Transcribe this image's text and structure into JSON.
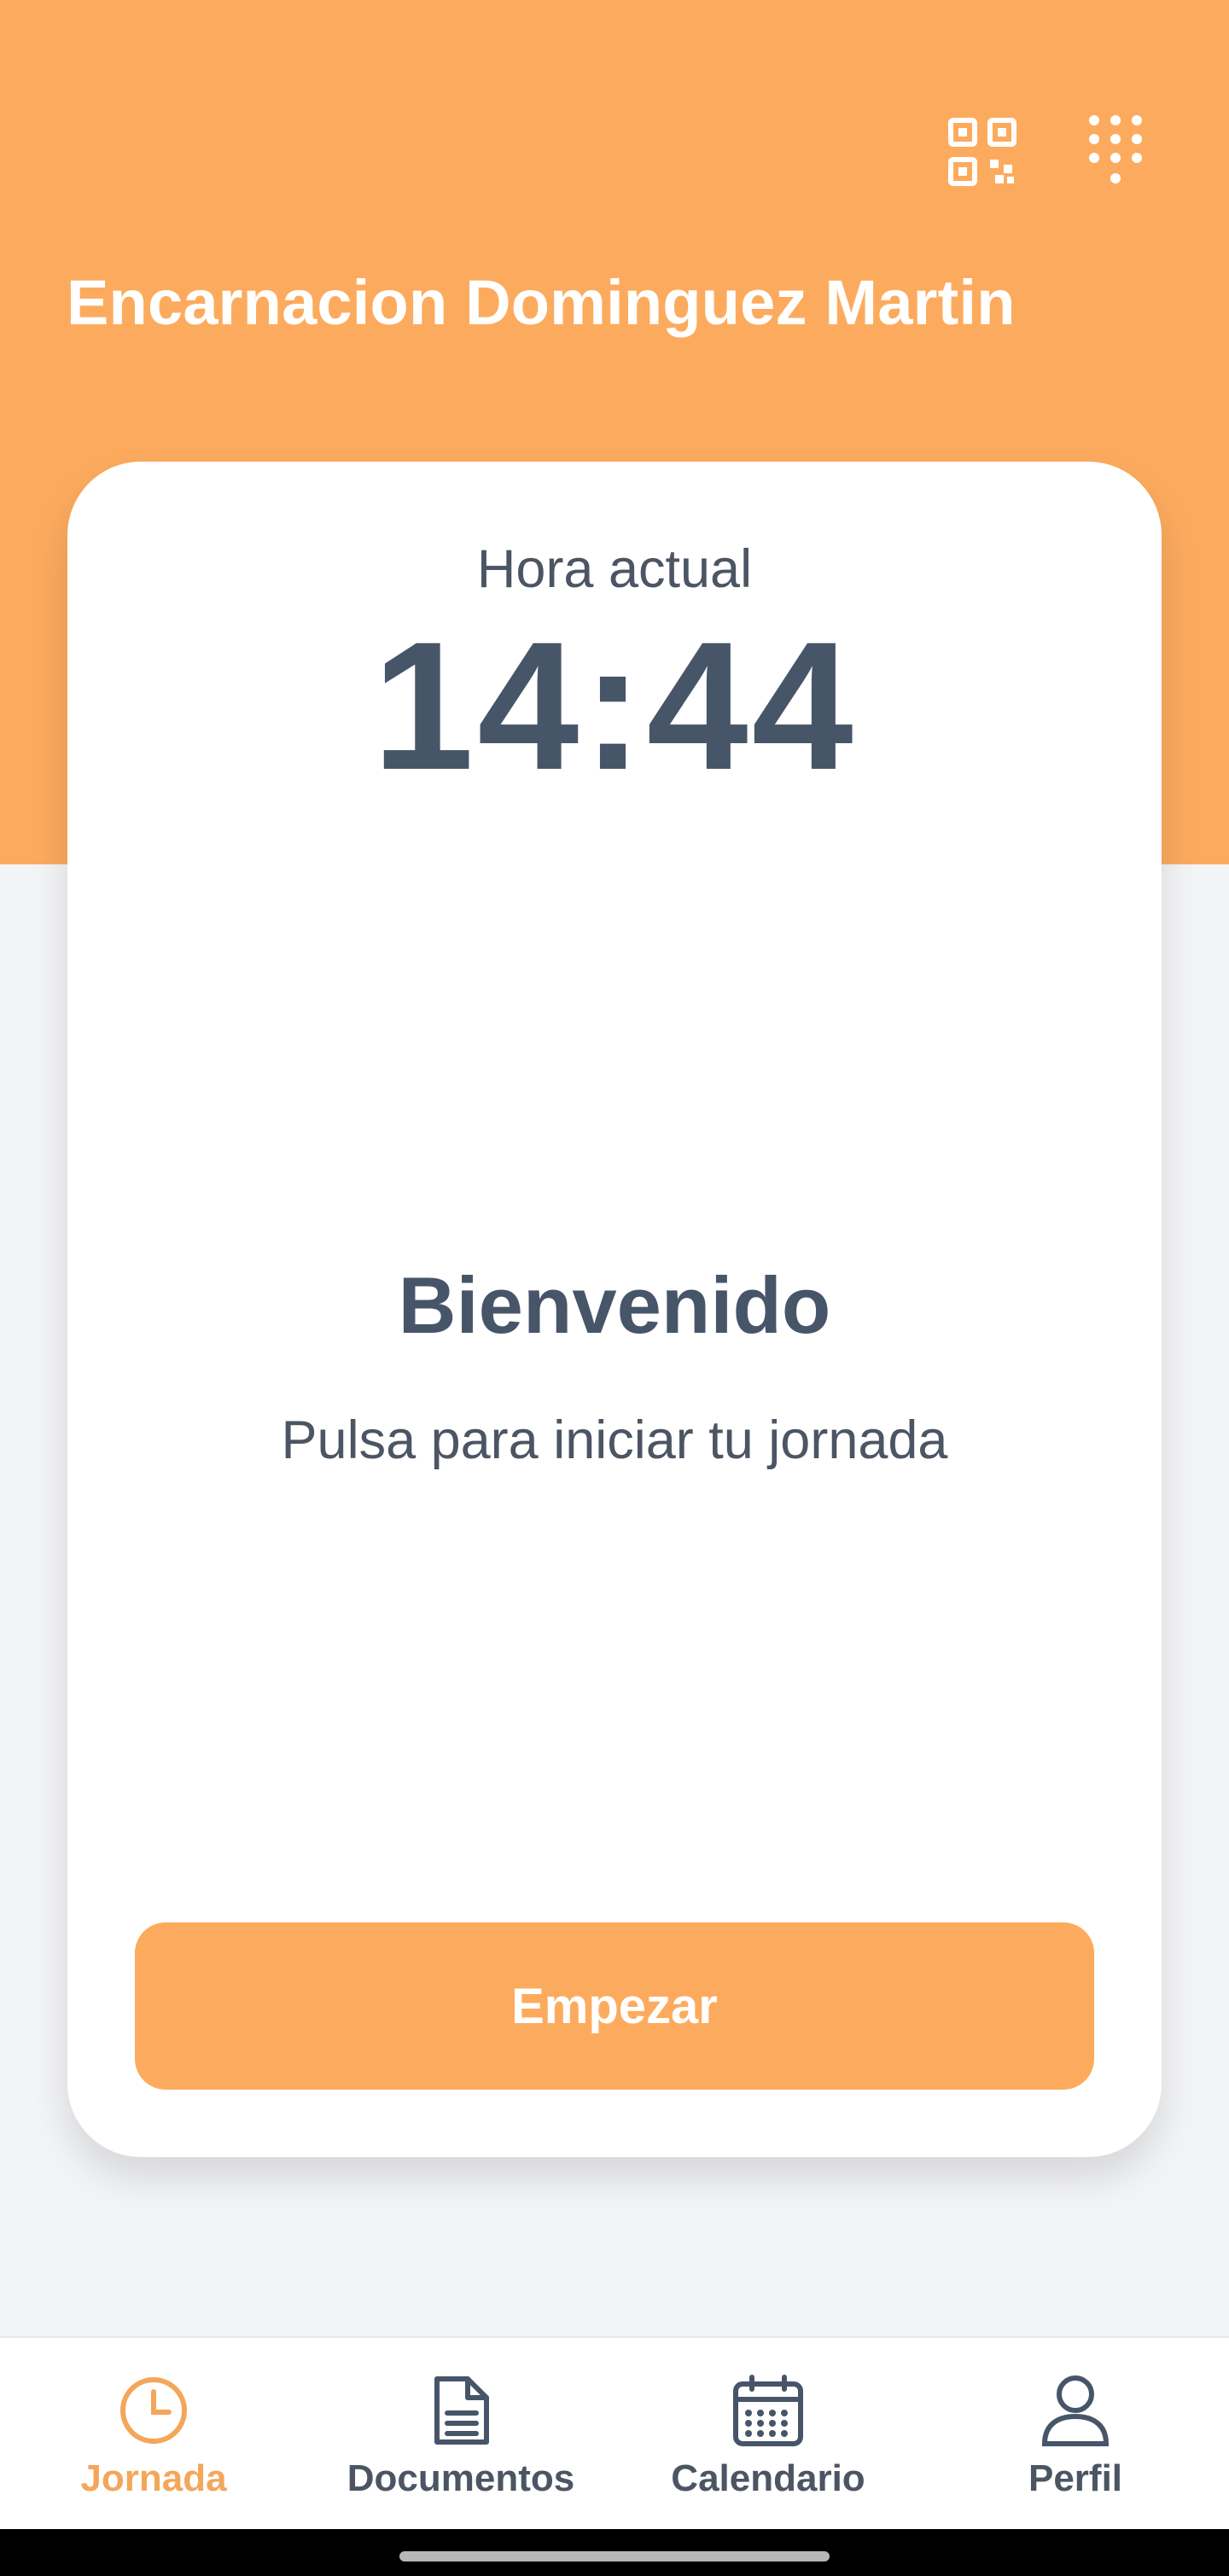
{
  "header": {
    "user_name": "Encarnacion Dominguez Martin",
    "icons": [
      "qr-code-icon",
      "dialpad-icon"
    ]
  },
  "clock": {
    "label": "Hora actual",
    "time": "14:44"
  },
  "welcome": {
    "title": "Bienvenido",
    "subtitle": "Pulsa para iniciar tu jornada"
  },
  "actions": {
    "start_label": "Empezar"
  },
  "nav": {
    "items": [
      {
        "label": "Jornada",
        "icon": "clock-icon",
        "active": true
      },
      {
        "label": "Documentos",
        "icon": "document-icon",
        "active": false
      },
      {
        "label": "Calendario",
        "icon": "calendar-icon",
        "active": false
      },
      {
        "label": "Perfil",
        "icon": "user-icon",
        "active": false
      }
    ]
  },
  "colors": {
    "accent": "#fcab5e",
    "text_dark": "#475569",
    "background": "#f3f4f6",
    "card": "#ffffff"
  }
}
